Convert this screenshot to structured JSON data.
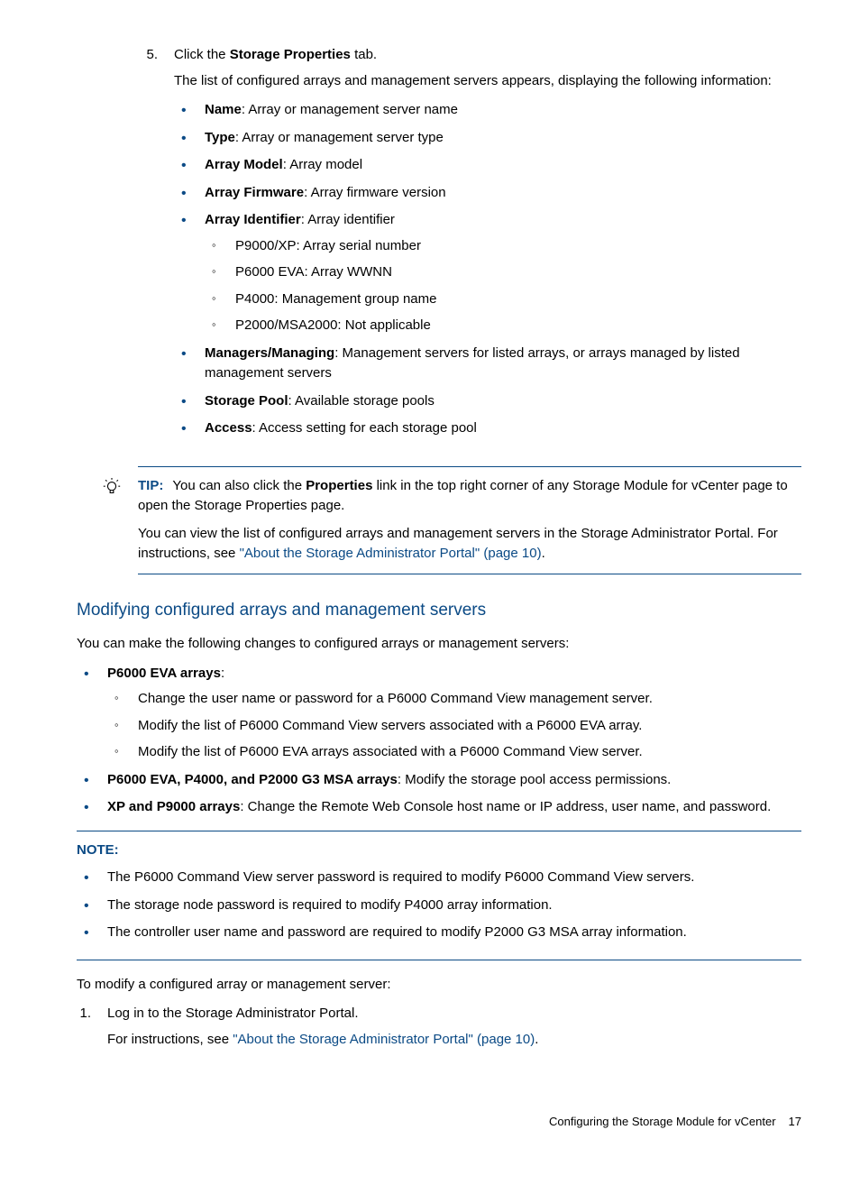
{
  "step5": {
    "number": "5.",
    "line_pre": "Click the ",
    "line_b": "Storage Properties",
    "line_post": " tab.",
    "desc": "The list of configured arrays and management servers appears, displaying the following information:",
    "bullets": [
      {
        "b": "Name",
        "t": ": Array or management server name"
      },
      {
        "b": "Type",
        "t": ": Array or management server type"
      },
      {
        "b": "Array Model",
        "t": ": Array model"
      },
      {
        "b": "Array Firmware",
        "t": ": Array firmware version"
      },
      {
        "b": "Array Identifier",
        "t": ": Array identifier",
        "sub": [
          "P9000/XP: Array serial number",
          "P6000 EVA: Array WWNN",
          "P4000: Management group name",
          "P2000/MSA2000: Not applicable"
        ]
      },
      {
        "b": "Managers/Managing",
        "t": ": Management servers for listed arrays, or arrays managed by listed management servers"
      },
      {
        "b": "Storage Pool",
        "t": ": Available storage pools"
      },
      {
        "b": "Access",
        "t": ": Access setting for each storage pool"
      }
    ]
  },
  "tip": {
    "label": "TIP:",
    "p1_a": "You can also click the ",
    "p1_b": "Properties",
    "p1_c": " link in the top right corner of any Storage Module for vCenter page to open the Storage Properties page.",
    "p2_a": "You can view the list of configured arrays and management servers in the Storage Administrator Portal. For instructions, see ",
    "p2_link": "\"About the Storage Administrator Portal\" (page 10)",
    "p2_b": "."
  },
  "section": {
    "heading": "Modifying configured arrays and management servers",
    "intro": "You can make the following changes to configured arrays or management servers:",
    "bullets": [
      {
        "b": "P6000 EVA arrays",
        "t": ":",
        "sub": [
          "Change the user name or password for a P6000 Command View management server.",
          "Modify the list of P6000 Command View servers associated with a P6000 EVA array.",
          "Modify the list of P6000 EVA arrays associated with a P6000 Command View server."
        ]
      },
      {
        "b": "P6000 EVA, P4000, and P2000 G3 MSA arrays",
        "t": ": Modify the storage pool access permissions."
      },
      {
        "b": "XP and P9000 arrays",
        "t": ": Change the Remote Web Console host name or IP address, user name, and password."
      }
    ]
  },
  "note": {
    "label": "NOTE:",
    "bullets": [
      "The P6000 Command View server password is required to modify P6000 Command View servers.",
      "The storage node password is required to modify P4000 array information.",
      "The controller user name and password are required to modify P2000 G3 MSA array information."
    ]
  },
  "post_note": {
    "intro": "To modify a configured array or management server:",
    "step1": {
      "number": "1.",
      "line": "Log in to the Storage Administrator Portal.",
      "desc_a": "For instructions, see ",
      "desc_link": "\"About the Storage Administrator Portal\" (page 10)",
      "desc_b": "."
    }
  },
  "footer": {
    "text": "Configuring the Storage Module for vCenter",
    "page": "17"
  }
}
